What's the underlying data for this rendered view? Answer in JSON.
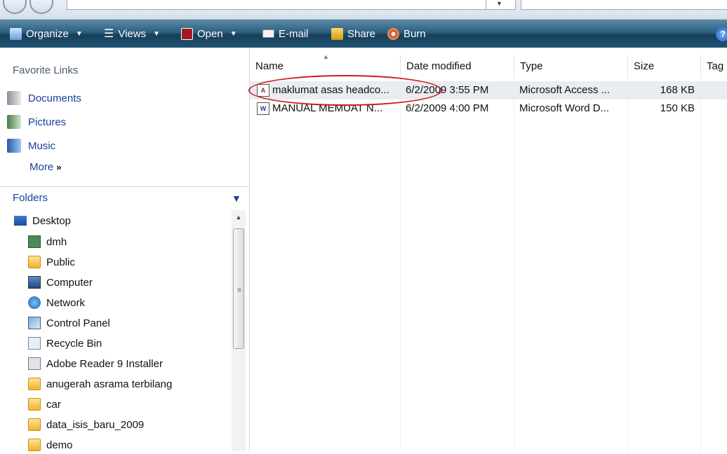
{
  "toolbar": {
    "organize": "Organize",
    "views": "Views",
    "open": "Open",
    "email": "E-mail",
    "share": "Share",
    "burn": "Burn",
    "help": "?"
  },
  "favorites": {
    "title": "Favorite Links",
    "items": [
      "Documents",
      "Pictures",
      "Music"
    ],
    "more": "More",
    "more_glyph": "»"
  },
  "folders": {
    "title": "Folders",
    "tree": [
      {
        "label": "Desktop",
        "icon": "desktop-icon"
      },
      {
        "label": "dmh",
        "icon": "user-folder-icon"
      },
      {
        "label": "Public",
        "icon": "folder-icon"
      },
      {
        "label": "Computer",
        "icon": "computer-icon"
      },
      {
        "label": "Network",
        "icon": "network-icon"
      },
      {
        "label": "Control Panel",
        "icon": "control-panel-icon"
      },
      {
        "label": "Recycle Bin",
        "icon": "recycle-bin-icon"
      },
      {
        "label": "Adobe Reader 9 Installer",
        "icon": "installer-icon"
      },
      {
        "label": "anugerah asrama terbilang",
        "icon": "folder-icon"
      },
      {
        "label": "car",
        "icon": "folder-icon"
      },
      {
        "label": "data_isis_baru_2009",
        "icon": "folder-icon"
      },
      {
        "label": "demo",
        "icon": "folder-icon"
      }
    ]
  },
  "filelist": {
    "columns": [
      "Name",
      "Date modified",
      "Type",
      "Size",
      "Tag"
    ],
    "rows": [
      {
        "name": "maklumat asas headco...",
        "date": "6/2/2009 3:55 PM",
        "type": "Microsoft Access ...",
        "size": "168 KB",
        "icon": "access-file-icon"
      },
      {
        "name": "MANUAL MEMUAT N...",
        "date": "6/2/2009 4:00 PM",
        "type": "Microsoft Word D...",
        "size": "150 KB",
        "icon": "word-file-icon"
      }
    ]
  },
  "colors": {
    "toolbar_dark": "#163f5a",
    "link_blue": "#1a3f9c",
    "highlight_oval": "#d0191f"
  }
}
